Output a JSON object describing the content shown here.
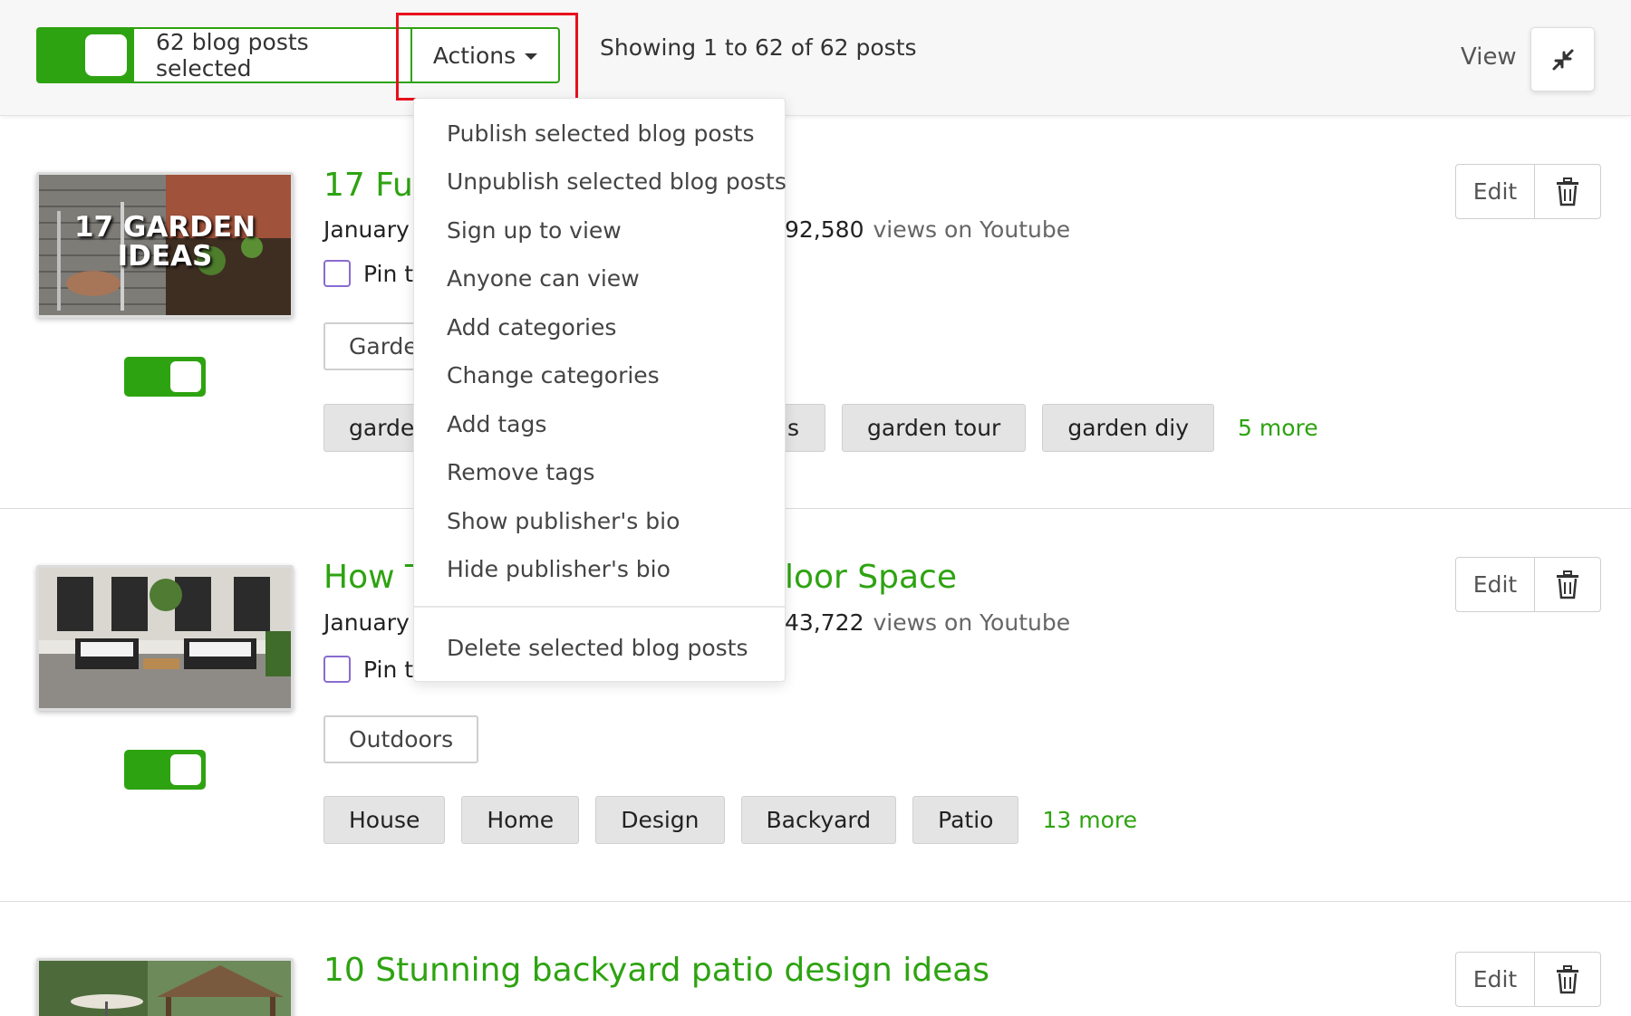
{
  "toolbar": {
    "selected_label": "62 blog posts selected",
    "actions_label": "Actions",
    "showing_text": "Showing 1 to 62 of 62 posts",
    "view_label": "View"
  },
  "actions_menu": {
    "items": [
      "Publish selected blog posts",
      "Unpublish selected blog posts",
      "Sign up to view",
      "Anyone can view",
      "Add categories",
      "Change categories",
      "Add tags",
      "Remove tags",
      "Show publisher's bio",
      "Hide publisher's bio"
    ],
    "delete_label": "Delete selected blog posts"
  },
  "posts": [
    {
      "title": "17 Fur",
      "date": "January",
      "youtube_views": "92,580",
      "views_label": "views on Youtube",
      "pin_label": "Pin t",
      "category": "Garde",
      "tags": [
        "garde"
      ],
      "right_tags": [
        "garden tour",
        "garden diy"
      ],
      "partial_tag_fragment": "s",
      "more": "5 more",
      "thumb_text": "17 GARDEN IDEAS",
      "edit_label": "Edit"
    },
    {
      "title": "How T",
      "title_tail": "loor Space",
      "date": "January",
      "youtube_views": "43,722",
      "views_label": "views on Youtube",
      "pin_label": "Pin t",
      "category": "Outdoors",
      "tags": [
        "House",
        "Home",
        "Design",
        "Backyard",
        "Patio"
      ],
      "more": "13 more",
      "edit_label": "Edit"
    },
    {
      "title": "10 Stunning backyard patio design ideas",
      "edit_label": "Edit"
    }
  ],
  "colors": {
    "brand_green": "#2ea311",
    "highlight_red": "#e8101c"
  }
}
